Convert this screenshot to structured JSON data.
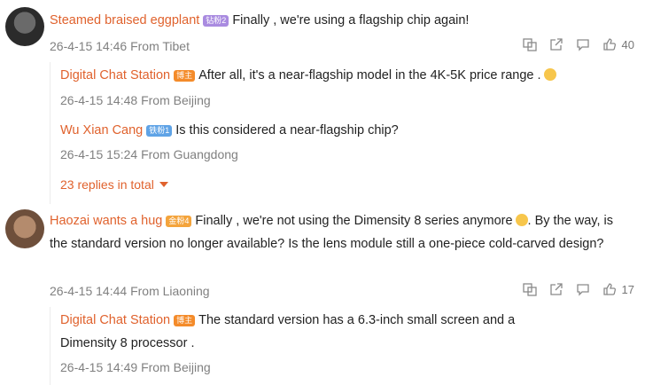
{
  "comments": [
    {
      "user": "Steamed braised eggplant",
      "badge": "钻粉2",
      "text": "Finally , we're using a flagship chip again!",
      "meta": "26-4-15 14:46 From Tibet",
      "likes": "40",
      "replies": [
        {
          "user": "Digital Chat Station",
          "badge": "博主",
          "text": "After all, it's a near-flagship model in the 4K-5K price range .",
          "meta": "26-4-15 14:48 From Beijing"
        },
        {
          "user": "Wu Xian Cang",
          "badge": "铁粉1",
          "text": "Is this considered a near-flagship chip?",
          "meta": "26-4-15 15:24 From Guangdong"
        }
      ],
      "more_replies": "23 replies in total"
    },
    {
      "user": "Haozai wants a hug",
      "badge": "金粉4",
      "text_part1": "Finally , we're not using the Dimensity 8 series anymore",
      "text_part2": ". By the way, is the standard version no longer available? Is the lens module still a one-piece cold-carved design?",
      "meta": "26-4-15 14:44 From Liaoning",
      "likes": "17",
      "replies": [
        {
          "user": "Digital Chat Station",
          "badge": "博主",
          "text": "The standard version has a 6.3-inch small screen and a Dimensity 8 processor .",
          "meta": "26-4-15 14:49 From Beijing"
        }
      ]
    }
  ],
  "icons": {
    "translate": "translate-icon",
    "share": "share-icon",
    "comment": "comment-icon",
    "like": "thumbs-up-icon",
    "expand": "caret-down-icon"
  }
}
